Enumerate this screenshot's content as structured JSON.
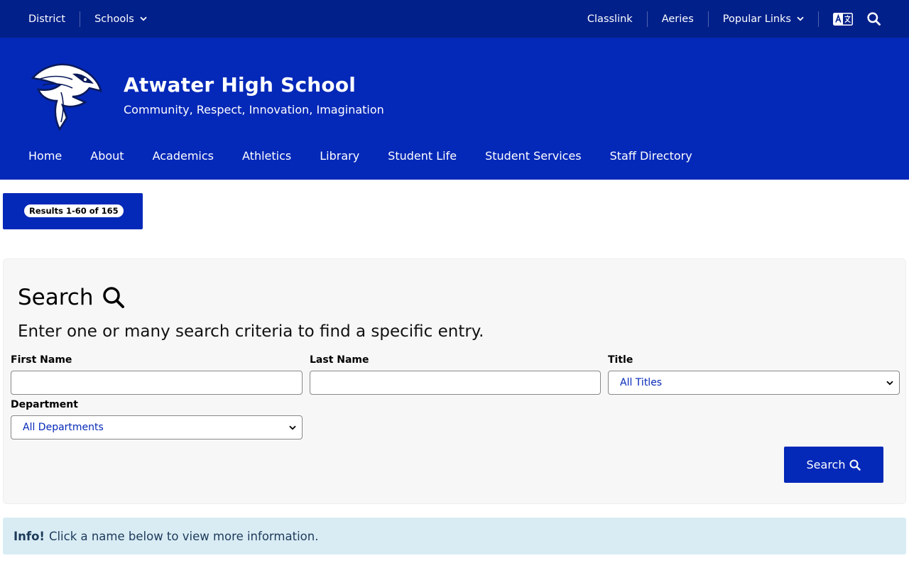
{
  "utility_bar": {
    "left_links": [
      "District",
      "Schools"
    ],
    "right_links": [
      "Classlink",
      "Aeries",
      "Popular Links"
    ],
    "icons": [
      "translate-icon",
      "search-icon",
      "chevron-down-icon"
    ]
  },
  "header": {
    "school_name": "Atwater High School",
    "tagline": "Community, Respect, Innovation, Imagination",
    "logo": "falcon-logo"
  },
  "main_nav": [
    "Home",
    "About",
    "Academics",
    "Athletics",
    "Library",
    "Student Life",
    "Student Services",
    "Staff Directory"
  ],
  "results": {
    "label": "Results 1-60 of 165"
  },
  "search": {
    "heading": "Search",
    "description": "Enter one or many search criteria to find a specific entry.",
    "fields": {
      "first_name_label": "First Name",
      "first_name_value": "",
      "last_name_label": "Last Name",
      "last_name_value": "",
      "title_label": "Title",
      "title_value": "All Titles",
      "department_label": "Department",
      "department_value": "All Departments"
    },
    "button_label": "Search"
  },
  "info": {
    "strong": "Info!",
    "text": "Click a name below to view more information."
  },
  "colors": {
    "utility_bar": "#02208a",
    "brand_blue": "#0428b8",
    "info_bg": "#d9ecf4",
    "panel_bg": "#f7f7f7"
  }
}
